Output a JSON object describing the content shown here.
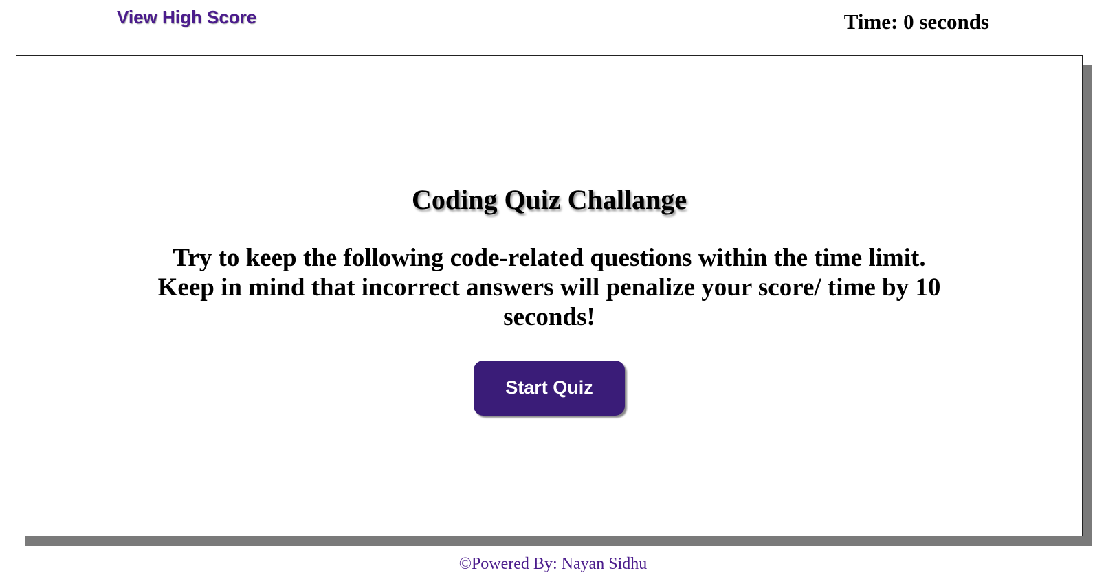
{
  "header": {
    "high_score_label": "View High Score",
    "timer_text": "Time: 0 seconds"
  },
  "quiz": {
    "title": "Coding Quiz Challange",
    "instructions": "Try to keep the following code-related questions within the time limit. Keep in mind that incorrect answers will penalize your score/ time by 10 seconds!",
    "start_button_label": "Start Quiz"
  },
  "footer": {
    "credit_text": "©Powered By: Nayan Sidhu"
  },
  "colors": {
    "accent": "#3a1c78",
    "link": "#4b1c8c",
    "card_shadow": "#7a7a7a"
  }
}
